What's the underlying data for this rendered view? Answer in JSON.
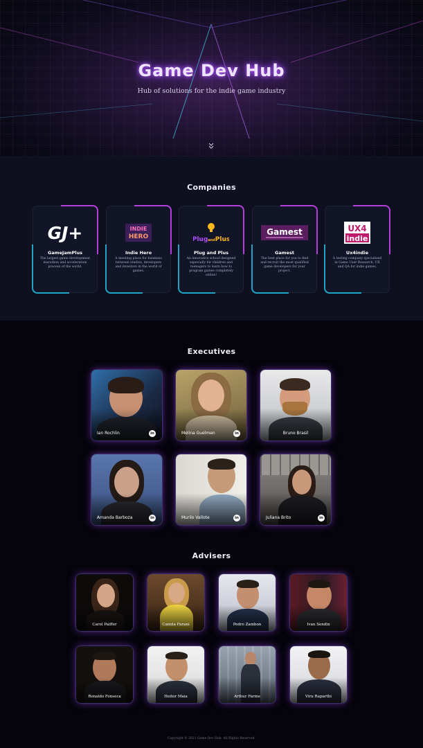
{
  "hero": {
    "title": "Game Dev Hub",
    "subtitle": "Hub of solutions for the indie game industry",
    "scroll_icon": "chevrons-down-icon"
  },
  "companies": {
    "title": "Companies",
    "items": [
      {
        "name": "GameJamPlus",
        "logo": "GJ+",
        "logo_icon": "gamejamplus-logo",
        "desc": "The largest game development marathon and acceleration process of the world."
      },
      {
        "name": "Indie Hero",
        "logo": "INDIE HERO",
        "logo_icon": "indie-hero-logo",
        "desc": "A meeting place for business between studios, developers and investors in the world of games."
      },
      {
        "name": "Plug and Plus",
        "logo": "Plug and Plus",
        "logo_icon": "plug-and-plus-logo",
        "desc": "An innovative school designed especially for children and teenagers to learn how to program games completely online!"
      },
      {
        "name": "Gamest",
        "logo": "Gamest",
        "logo_icon": "gamest-logo",
        "desc": "The best place for you to find and recruit the most qualified game developers for your project."
      },
      {
        "name": "Ux4indie",
        "logo": "UX4 indie",
        "logo_icon": "ux4indie-logo",
        "desc": "A testing company specialized in Game User Research, UX and QA for indie games."
      }
    ],
    "colors": {
      "accent_purple": "#b43fd9",
      "accent_cyan": "#1fa6c6"
    }
  },
  "executives": {
    "title": "Executives",
    "people": [
      {
        "name": "Ian Rochlin",
        "linkedin": true
      },
      {
        "name": "Melina Guelmen",
        "linkedin": true
      },
      {
        "name": "Bruno Brasil",
        "linkedin": false
      },
      {
        "name": "Amanda Barboza",
        "linkedin": true
      },
      {
        "name": "Murilo Vallote",
        "linkedin": true
      },
      {
        "name": "Juliana Brito",
        "linkedin": true
      }
    ]
  },
  "advisers": {
    "title": "Advisers",
    "people": [
      {
        "name": "Carol Paiffer"
      },
      {
        "name": "Camila Farani"
      },
      {
        "name": "Pedro Zambon"
      },
      {
        "name": "Ivan Sendin"
      },
      {
        "name": "Ronaldo Fonseca"
      },
      {
        "name": "Heitor Maia"
      },
      {
        "name": "Arthur Farme"
      },
      {
        "name": "Viru Raparthi"
      }
    ]
  },
  "linkedin_label": "in",
  "footer": "Copyright © 2021 Game Dev Hub. All Rights Reserved."
}
